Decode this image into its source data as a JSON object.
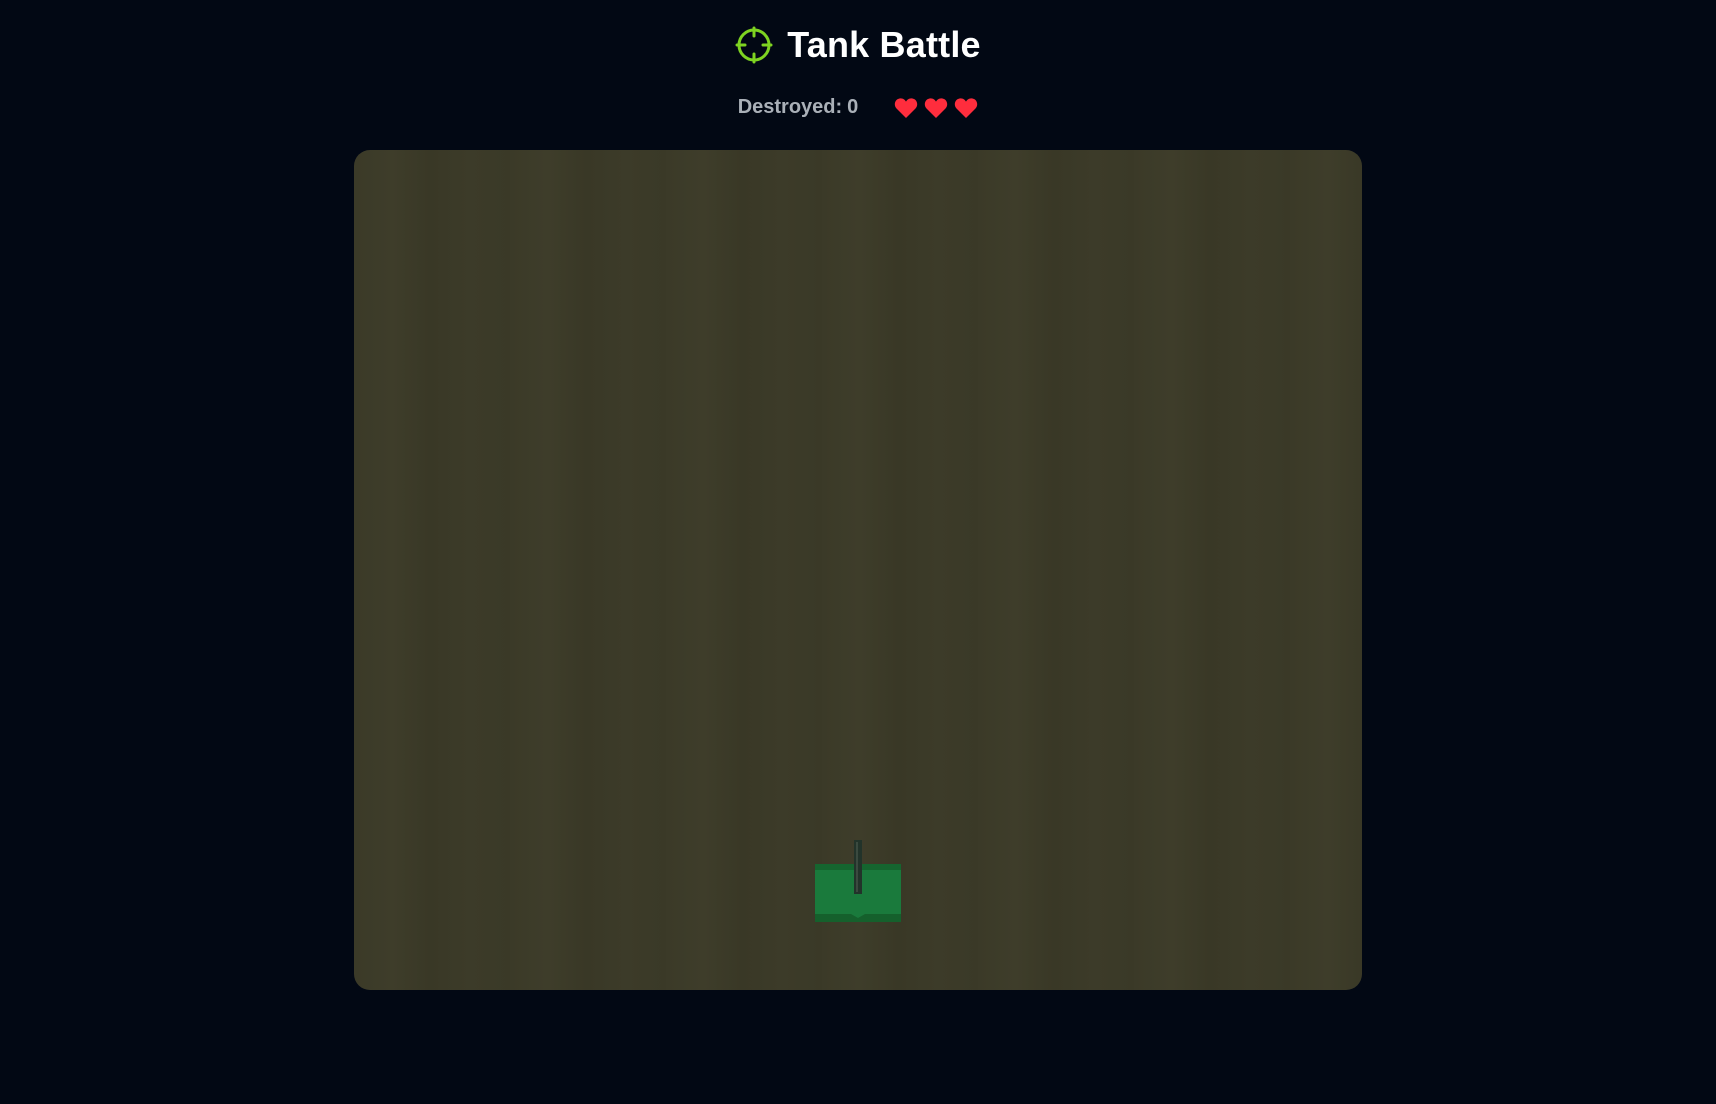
{
  "header": {
    "title": "Tank Battle",
    "title_icon": "crosshair-icon",
    "accent_color": "#7ed321"
  },
  "stats": {
    "destroyed_label": "Destroyed:",
    "destroyed_value": "0",
    "lives": 3,
    "life_icon": "heart-icon",
    "life_color": "#ff2d3d"
  },
  "arena": {
    "background_color": "#3c3b29",
    "player_tank_color": "#1a7a3c"
  }
}
